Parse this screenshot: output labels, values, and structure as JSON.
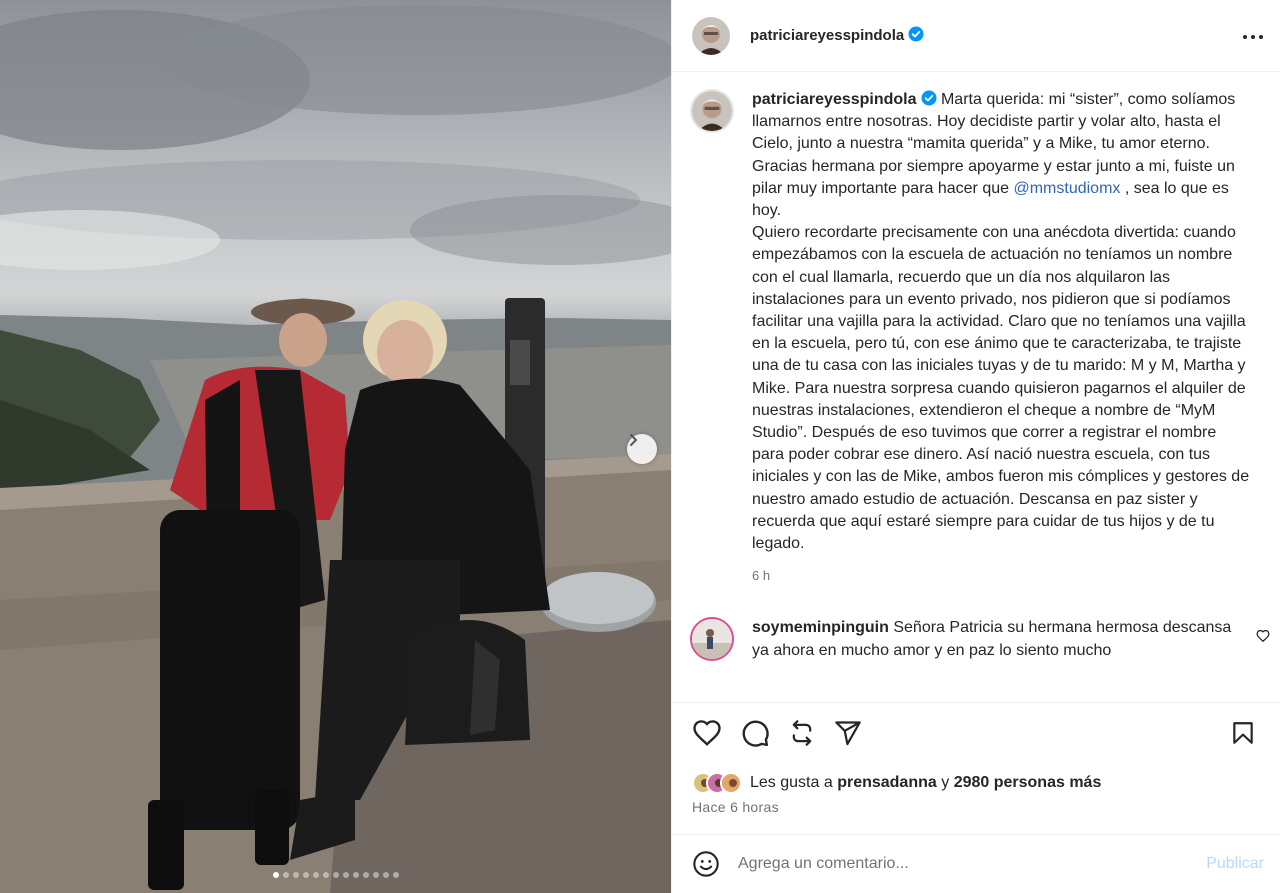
{
  "post": {
    "author": "patriciareyesspindola",
    "verified": true,
    "photo_count": 13,
    "active_photo": 1
  },
  "caption": {
    "author": "patriciareyesspindola",
    "text_before_mention": "Marta querida: mi “sister”, como solíamos llamarnos entre nosotras. Hoy decidiste partir y volar alto, hasta el Cielo, junto a nuestra “mamita querida” y a Mike, tu amor eterno.\nGracias hermana por siempre apoyarme y estar junto a mi, fuiste un pilar muy importante para hacer que ",
    "mention": "@mmstudiomx",
    "text_after_mention": " , sea lo que es hoy.\nQuiero recordarte precisamente con una anécdota divertida: cuando empezábamos con la escuela de actuación no teníamos un nombre con el cual llamarla, recuerdo que un día nos alquilaron las instalaciones para un evento privado, nos pidieron que si podíamos facilitar una vajilla para la actividad. Claro que no teníamos una vajilla en la escuela, pero tú, con ese ánimo que te caracterizaba, te trajiste una de tu casa con las iniciales tuyas y de tu marido: M y M, Martha y Mike. Para nuestra sorpresa cuando quisieron pagarnos el alquiler de nuestras instalaciones, extendieron el cheque a nombre de “MyM Studio”. Después de eso tuvimos que correr a registrar el nombre para poder cobrar ese dinero. Así nació nuestra escuela, con tus iniciales y con las de Mike, ambos fueron mis cómplices y gestores de nuestro amado estudio de actuación. Descansa en paz sister y recuerda que aquí estaré siempre para cuidar de tus hijos y de tu legado.",
    "time": "6 h"
  },
  "comment": {
    "author": "soymeminpinguin",
    "text": "Señora Patricia su hermana hermosa descansa ya ahora en mucho amor y en paz lo siento mucho"
  },
  "likes": {
    "prefix": "Les gusta a",
    "user": "prensadanna",
    "connector": "y",
    "count": "2980 personas más"
  },
  "timestamp": "Hace 6 horas",
  "add_comment": {
    "placeholder": "Agrega un comentario...",
    "publish": "Publicar"
  },
  "colors": {
    "verified": "#0095f6",
    "mention": "#2f64b8",
    "publish_disabled": "#b3dbff",
    "muted": "#737373"
  }
}
